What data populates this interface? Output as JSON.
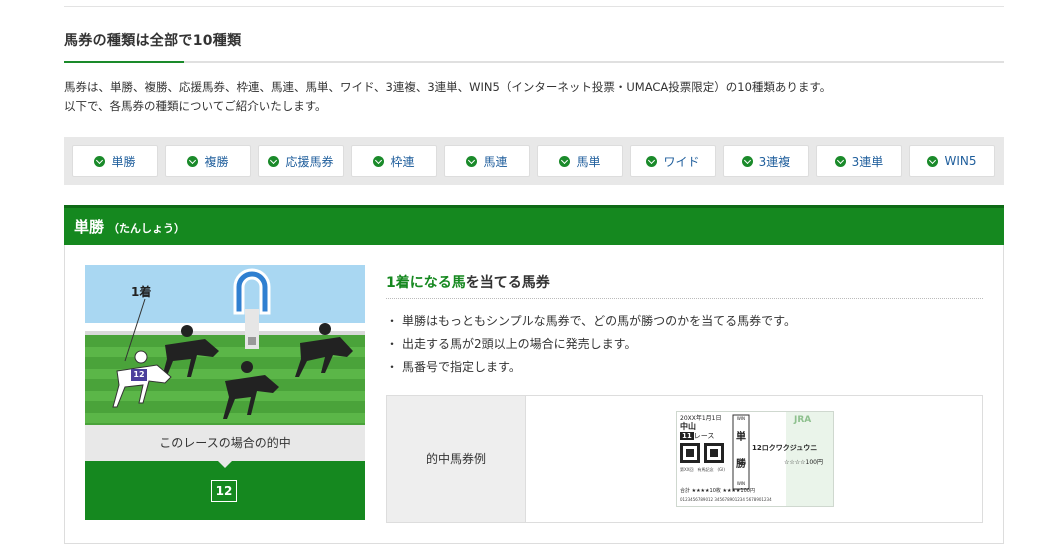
{
  "section": {
    "title": "馬券の種類は全部で10種類",
    "intro_line1": "馬券は、単勝、複勝、応援馬券、枠連、馬連、馬単、ワイド、3連複、3連単、WIN5（インターネット投票・UMACA投票限定）の10種類あります。",
    "intro_line2": "以下で、各馬券の種類についてご紹介いたします。"
  },
  "tabs": [
    {
      "label": "単勝"
    },
    {
      "label": "複勝"
    },
    {
      "label": "応援馬券"
    },
    {
      "label": "枠連"
    },
    {
      "label": "馬連"
    },
    {
      "label": "馬単"
    },
    {
      "label": "ワイド"
    },
    {
      "label": "3連複"
    },
    {
      "label": "3連単"
    },
    {
      "label": "WIN5"
    }
  ],
  "detail": {
    "title": "単勝",
    "reading": "（たんしょう）",
    "illustration": {
      "place_label": "1着",
      "horse_number": "12",
      "caption": "このレースの場合の的中",
      "winning_number": "12"
    },
    "heading_highlight": "1着になる馬",
    "heading_rest": "を当てる馬券",
    "bullets": [
      "単勝はもっともシンプルな馬券で、どの馬が勝つのかを当てる馬券です。",
      "出走する馬が2頭以上の場合に発売します。",
      "馬番号で指定します。"
    ],
    "example_label": "的中馬券例",
    "ticket": {
      "date": "20XX年1月1日",
      "venue": "中山",
      "race_no": "11",
      "race_suffix": "レース",
      "bet_type_1": "単",
      "bet_type_2": "勝",
      "win_top": "WIN",
      "win_bottom": "WIN",
      "horse": "12ロクワクジュウニ",
      "amount": "☆☆☆☆100円",
      "brand": "JRA",
      "race_name": "第XX回　有馬記念　(GI)",
      "total": "合計 ★★★★10枚 ★★★★100円",
      "serial": "0123456789012 345678901234 5678901234"
    }
  },
  "colors": {
    "accent_green": "#15881f",
    "link_blue": "#1f5e9c",
    "tab_bar_gray": "#e8e8e8"
  }
}
